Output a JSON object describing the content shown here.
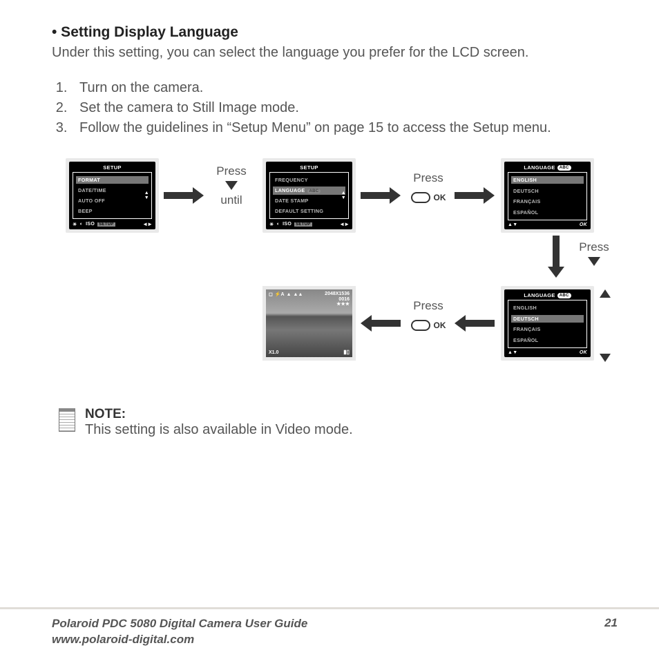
{
  "heading": "• Setting Display Language",
  "intro": "Under this setting, you can select the language you prefer for the LCD screen.",
  "steps": [
    "Turn on the camera.",
    "Set the camera to Still Image mode.",
    "Follow the guidelines in “Setup Menu” on page 15 to access the Setup menu."
  ],
  "screens": {
    "setup1": {
      "title": "SETUP",
      "items": [
        "FORMAT",
        "DATE/TIME",
        "AUTO OFF",
        "BEEP"
      ],
      "highlight_index": 0,
      "iso_label": "ISO",
      "setup_tab": "SETUP"
    },
    "setup2": {
      "title": "SETUP",
      "items": [
        "FREQUENCY",
        "LANGUAGE",
        "DATE STAMP",
        "DEFAULT SETTING"
      ],
      "highlight_index": 1,
      "abc_badge": "ABC",
      "iso_label": "ISO",
      "setup_tab": "SETUP"
    },
    "lang1": {
      "title": "LANGUAGE",
      "abc_badge": "ABC",
      "items": [
        "ENGLISH",
        "DEUTSCH",
        "FRANÇAIS",
        "ESPAÑOL"
      ],
      "highlight_index": 0,
      "ok": "OK"
    },
    "lang2": {
      "title": "LANGUAGE",
      "abc_badge": "ABC",
      "items": [
        "ENGLISH",
        "DEUTSCH",
        "FRANÇAIS",
        "ESPAÑOL"
      ],
      "highlight_index": 1,
      "ok": "OK"
    },
    "preview": {
      "flash": "⚡A",
      "resolution": "2048X1536",
      "counter": "0016",
      "stars": "★★★",
      "zoom": "X1.0"
    }
  },
  "instructions": {
    "press": "Press",
    "until": "until",
    "ok": "OK"
  },
  "note": {
    "title": "NOTE:",
    "body": "This setting is also available in Video mode."
  },
  "footer": {
    "line1": "Polaroid PDC 5080 Digital Camera User Guide",
    "line2": "www.polaroid-digital.com",
    "page": "21"
  }
}
